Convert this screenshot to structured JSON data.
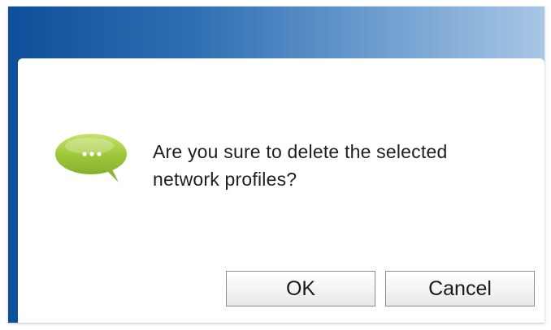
{
  "dialog": {
    "message": "Are you sure to delete the selected network profiles?",
    "icon": "speech-bubble-icon",
    "buttons": {
      "ok_label": "OK",
      "cancel_label": "Cancel"
    }
  },
  "colors": {
    "title_bar_start": "#0d4f9a",
    "title_bar_end": "#a8c6e5",
    "icon_green": "#9dc63a"
  }
}
